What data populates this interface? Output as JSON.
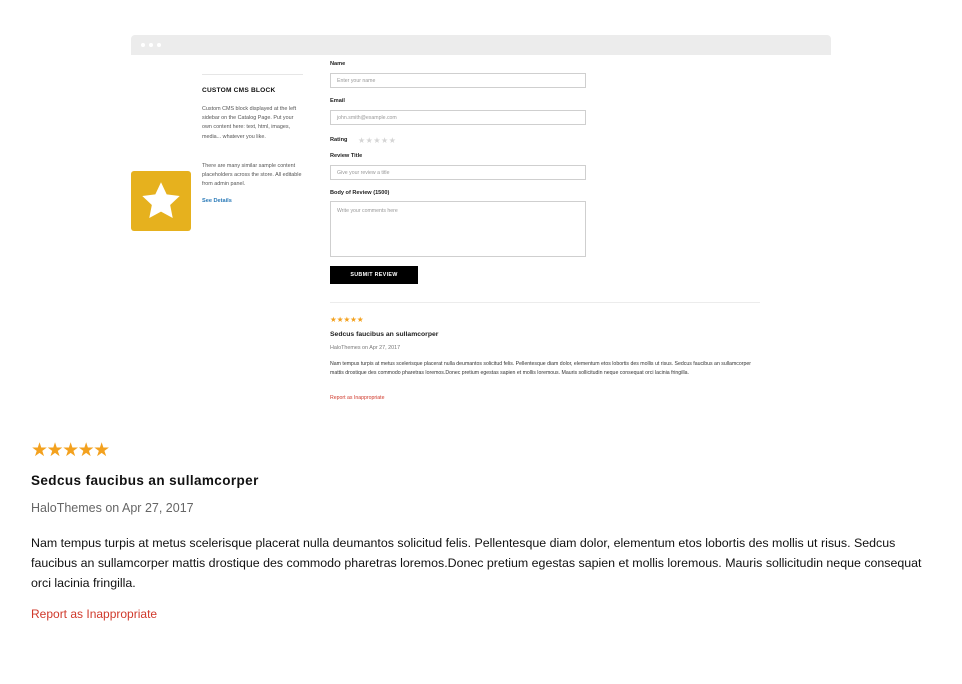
{
  "preview": {
    "cms": {
      "title": "CUSTOM CMS BLOCK",
      "para1": "Custom CMS block displayed at the left sidebar on the Catalog Page. Put your own content here: text, html, images, media... whatever you like.",
      "para2": "There are many similar sample content placeholders across the store. All editable from admin panel.",
      "link": "See Details"
    },
    "form": {
      "name_label": "Name",
      "name_placeholder": "Enter your name",
      "email_label": "Email",
      "email_placeholder": "john.smith@example.com",
      "rating_label": "Rating",
      "rating_stars": "★★★★★",
      "title_label": "Review Title",
      "title_placeholder": "Give your review a title",
      "body_label": "Body of Review (1500)",
      "body_placeholder": "Write your comments here",
      "submit_label": "SUBMIT REVIEW"
    },
    "review": {
      "stars": "★★★★★",
      "title": "Sedcus faucibus an sullamcorper",
      "meta": "HaloThemes on Apr 27, 2017",
      "body": "Nam tempus turpis at metus scelerisque placerat nulla deumantos solicitud felis. Pellentesque diam dolor, elementum etos lobortis des mollis ut risus. Sedcus faucibus an sullamcorper mattis drostique des commodo pharetras loremos.Donec pretium egestas sapien et mollis loremous. Mauris sollicitudin neque consequat orci lacinia fringilla.",
      "report": "Report as Inappropriate"
    }
  },
  "review": {
    "stars": "★★★★★",
    "rating_value": 5,
    "rating_max": 5,
    "title": "Sedcus faucibus an sullamcorper",
    "meta": "HaloThemes on Apr 27, 2017",
    "body": "Nam tempus turpis at metus scelerisque placerat nulla deumantos solicitud felis. Pellentesque diam dolor, elementum etos lobortis des mollis ut risus. Sedcus faucibus an sullamcorper mattis drostique des commodo pharetras loremos.Donec pretium egestas sapien et mollis loremous. Mauris sollicitudin neque consequat orci lacinia fringilla.",
    "report": "Report as Inappropriate"
  },
  "colors": {
    "star": "#f3a11e",
    "badge": "#e6b11e",
    "report": "#d0392b",
    "link": "#2a7ab8"
  },
  "icons": {
    "badge": "star-icon"
  }
}
